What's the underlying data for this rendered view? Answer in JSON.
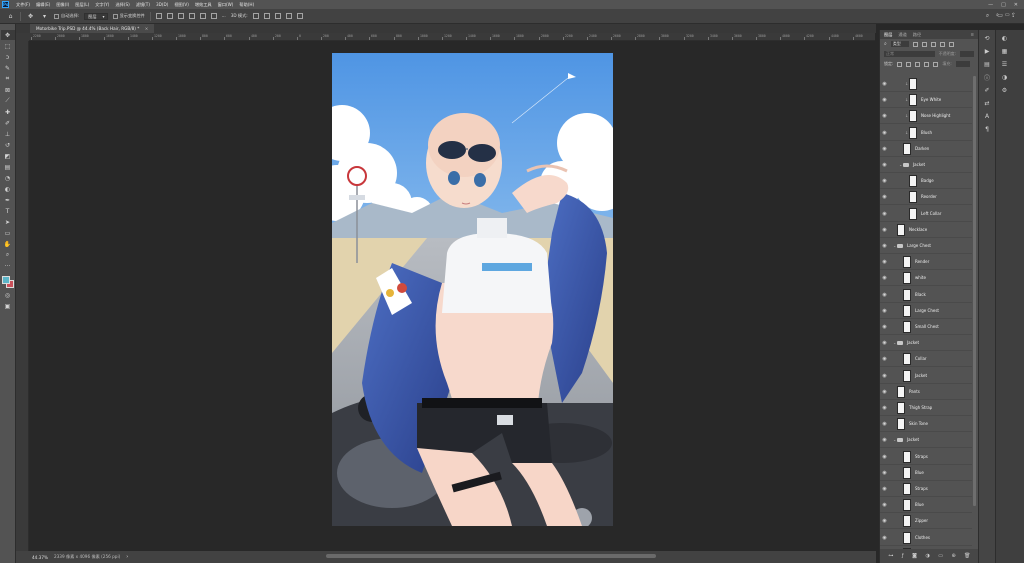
{
  "menubar": {
    "logo": "Ps",
    "items": [
      "文件(F)",
      "编辑(E)",
      "图像(I)",
      "图层(L)",
      "文字(Y)",
      "选择(S)",
      "滤镜(T)",
      "3D(D)",
      "视图(V)",
      "增效工具",
      "窗口(W)",
      "帮助(H)"
    ],
    "window_buttons": [
      "—",
      "□",
      "✕"
    ]
  },
  "options": {
    "auto_select_label": "自动选择:",
    "auto_select_value": "图层",
    "transform_label": "显示变换控件",
    "more_label": "···",
    "three_d_label": "3D 模式:"
  },
  "document": {
    "tab_title": "Motorbike Trip.PSD @ 44.4% (Back Hair, RGB/8) *",
    "tab_close": "×",
    "ruler_labels": [
      "2200",
      "2000",
      "1800",
      "1600",
      "1400",
      "1200",
      "1000",
      "800",
      "600",
      "400",
      "200",
      "0",
      "200",
      "400",
      "600",
      "800",
      "1000",
      "1200",
      "1400",
      "1600",
      "1800",
      "2000",
      "2200",
      "2400",
      "2600",
      "2800",
      "3000",
      "3200",
      "3400",
      "3600",
      "3800",
      "4000",
      "4200",
      "4400",
      "4600"
    ]
  },
  "status": {
    "zoom": "44.37%",
    "info": "2339 像素 x 4096 像素 (256 ppi)",
    "arrow": "›"
  },
  "colors": {
    "foreground": "#5cb5c8",
    "background": "#c9505a",
    "accent": "#31a8ff"
  },
  "layers_panel": {
    "tabs": [
      "图层",
      "通道",
      "路径"
    ],
    "filter_kind": "类型",
    "blend_mode": "正常",
    "opacity_label": "不透明度:",
    "lock_label": "锁定:",
    "fill_label": "填充:",
    "layers": [
      {
        "name": "",
        "type": "layer",
        "indent": 2,
        "clip": true
      },
      {
        "name": "Eye White",
        "type": "layer",
        "indent": 2,
        "clip": true
      },
      {
        "name": "Nose Highlight",
        "type": "layer",
        "indent": 2,
        "clip": true
      },
      {
        "name": "Blush",
        "type": "layer",
        "indent": 2,
        "clip": true
      },
      {
        "name": "Darken",
        "type": "layer",
        "indent": 1,
        "clip": false
      },
      {
        "name": "Jacket",
        "type": "group",
        "indent": 1
      },
      {
        "name": "Badge",
        "type": "layer",
        "indent": 2,
        "clip": false
      },
      {
        "name": "Reorder",
        "type": "layer",
        "indent": 2,
        "clip": false
      },
      {
        "name": "Left Collar",
        "type": "layer",
        "indent": 2,
        "clip": false
      },
      {
        "name": "Necklace",
        "type": "layer",
        "indent": 0,
        "clip": false
      },
      {
        "name": "Large Chest",
        "type": "group",
        "indent": 0
      },
      {
        "name": "Render",
        "type": "layer",
        "indent": 1,
        "clip": false
      },
      {
        "name": "white",
        "type": "layer",
        "indent": 1,
        "clip": false
      },
      {
        "name": "Black",
        "type": "layer",
        "indent": 1,
        "clip": false
      },
      {
        "name": "Large Chest",
        "type": "layer",
        "indent": 1,
        "clip": false
      },
      {
        "name": "Small Chest",
        "type": "layer",
        "indent": 1,
        "clip": false
      },
      {
        "name": "Jacket",
        "type": "group",
        "indent": 0
      },
      {
        "name": "Collar",
        "type": "layer",
        "indent": 1,
        "clip": false
      },
      {
        "name": "Jacket",
        "type": "layer",
        "indent": 1,
        "clip": false
      },
      {
        "name": "Pants",
        "type": "layer",
        "indent": 0,
        "clip": false
      },
      {
        "name": "Thigh Strap",
        "type": "layer",
        "indent": 0,
        "clip": false
      },
      {
        "name": "Skin Tone",
        "type": "layer",
        "indent": 0,
        "clip": false
      },
      {
        "name": "Jacket",
        "type": "group",
        "indent": 0
      },
      {
        "name": "Straps",
        "type": "layer",
        "indent": 1,
        "clip": false
      },
      {
        "name": "Blue",
        "type": "layer",
        "indent": 1,
        "clip": false
      },
      {
        "name": "Straps",
        "type": "layer",
        "indent": 1,
        "clip": false
      },
      {
        "name": "Blue",
        "type": "layer",
        "indent": 1,
        "clip": false
      },
      {
        "name": "Zipper",
        "type": "layer",
        "indent": 1,
        "clip": false
      },
      {
        "name": "Clothes",
        "type": "layer",
        "indent": 1,
        "clip": false
      },
      {
        "name": "Inner",
        "type": "layer",
        "indent": 1,
        "clip": false
      },
      {
        "name": "Back Hair",
        "type": "layer",
        "indent": 0,
        "clip": false,
        "selected": true
      }
    ],
    "footer_icons": [
      "link-icon",
      "fx-icon",
      "mask-icon",
      "adjustment-icon",
      "folder-icon",
      "new-layer-icon",
      "trash-icon"
    ]
  }
}
